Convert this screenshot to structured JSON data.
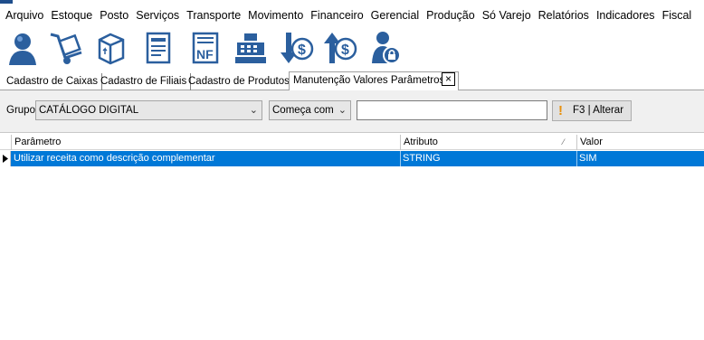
{
  "menu": [
    "Arquivo",
    "Estoque",
    "Posto",
    "Serviços",
    "Transporte",
    "Movimento",
    "Financeiro",
    "Gerencial",
    "Produção",
    "Só Varejo",
    "Relatórios",
    "Indicadores",
    "Fiscal"
  ],
  "toolbar": {
    "icons": [
      "user-icon",
      "hand-truck-icon",
      "box-icon",
      "document-list-icon",
      "nf-invoice-icon",
      "cash-register-icon",
      "money-down-icon",
      "money-up-icon",
      "user-lock-icon"
    ]
  },
  "tabs": [
    "Cadastro de Caixas",
    "Cadastro de Filiais",
    "Cadastro de Produtos",
    "Manutenção Valores Parâmetros"
  ],
  "tab_close_glyph": "×",
  "filter": {
    "grupo_label": "Grupo",
    "grupo_value": "CATÁLOGO DIGITAL",
    "match_value": "Começa com",
    "search_value": "",
    "alterar_label": "F3 | Alterar",
    "alterar_icon": "!"
  },
  "grid": {
    "columns": [
      "Parâmetro",
      "Atributo",
      "Valor"
    ],
    "rows": [
      {
        "parametro": "Utilizar receita como descrição complementar",
        "atributo": "STRING",
        "valor": "SIM"
      }
    ]
  },
  "colors": {
    "selection": "#0078d7",
    "alterar_icon": "#e8900c"
  }
}
